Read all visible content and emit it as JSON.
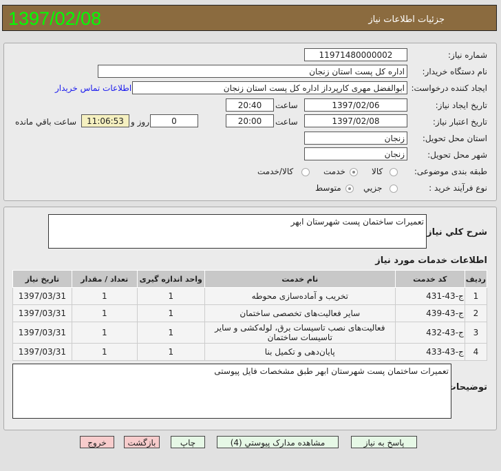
{
  "header": {
    "title": "جزئیات اطلاعات نیاز",
    "date": "1397/02/08"
  },
  "form": {
    "need_number": {
      "label": "شماره نیاز:",
      "value": "11971480000002"
    },
    "buyer_org": {
      "label": "نام دستگاه خریدار:",
      "value": "اداره کل پست استان زنجان"
    },
    "requester": {
      "label": "ایجاد کننده درخواست:",
      "value": "ابوالفضل مهری کارپرداز اداره کل پست استان زنجان",
      "contact_link": "اطلاعات تماس خریدار"
    },
    "created": {
      "label": "تاریخ ایجاد نیاز:",
      "date": "1397/02/06",
      "time_label": "ساعت",
      "time": "20:40"
    },
    "validity": {
      "label": "تاریخ اعتبار نیاز:",
      "date": "1397/02/08",
      "time_label": "ساعت",
      "time": "20:00",
      "days": "0",
      "days_label": "روز و",
      "remaining": "11:06:53",
      "remaining_label": "ساعت باقي مانده"
    },
    "province": {
      "label": "استان محل تحویل:",
      "value": "زنجان"
    },
    "city": {
      "label": "شهر محل تحویل:",
      "value": "زنجان"
    },
    "category": {
      "label": "طبقه بندی موضوعی:",
      "options": [
        "کالا",
        "خدمت",
        "کالا/خدمت"
      ],
      "selected": "خدمت"
    },
    "process": {
      "label": "نوع فرآیند خرید :",
      "options": [
        "جزیي",
        "متوسط"
      ],
      "selected": "متوسط"
    }
  },
  "description": {
    "label": "شرح کلي نیاز:",
    "value": "تعمیرات ساختمان پست شهرستان ابهر"
  },
  "services": {
    "title": "اطلاعات خدمات مورد نیاز",
    "columns": [
      "ردیف",
      "کد خدمت",
      "نام خدمت",
      "واحد اندازه گیری",
      "تعداد / مقدار",
      "تاریخ نیاز"
    ],
    "rows": [
      [
        "1",
        "ج-43-431",
        "تخریب و آماده‌سازی محوطه",
        "1",
        "1",
        "1397/03/31"
      ],
      [
        "2",
        "ج-43-439",
        "سایر فعالیت‌های تخصصی ساختمان",
        "1",
        "1",
        "1397/03/31"
      ],
      [
        "3",
        "ج-43-432",
        "فعالیت‌های نصب تاسیسات برق، لوله‌کشی و سایر تاسیسات ساختمان",
        "1",
        "1",
        "1397/03/31"
      ],
      [
        "4",
        "ج-43-433",
        "پایان‌دهی و تکمیل بنا",
        "1",
        "1",
        "1397/03/31"
      ]
    ]
  },
  "buyer_notes": {
    "label": "توضیحات خریدار:",
    "value": "تعمیرات ساختمان پست شهرستان ابهر طبق مشخصات فایل پیوستی"
  },
  "buttons": {
    "reply": "پاسخ به نیاز",
    "docs": "مشاهده مدارک پیوستي (4)",
    "print": "چاپ",
    "back": "بازگشت",
    "exit": "خروج"
  }
}
